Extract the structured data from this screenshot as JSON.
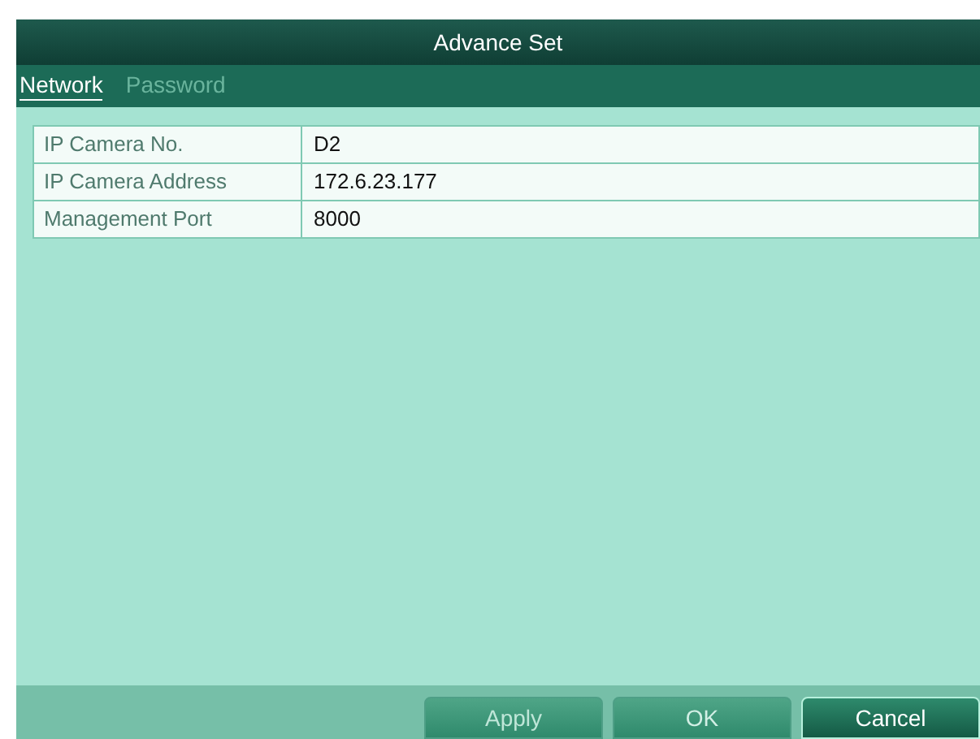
{
  "window": {
    "title": "Advance Set"
  },
  "tabs": [
    {
      "label": "Network",
      "selected": true
    },
    {
      "label": "Password",
      "selected": false
    }
  ],
  "fields": [
    {
      "label": "IP Camera No.",
      "value": "D2"
    },
    {
      "label": "IP Camera Address",
      "value": "172.6.23.177"
    },
    {
      "label": "Management Port",
      "value": "8000"
    }
  ],
  "buttons": [
    {
      "label": "Apply",
      "disabled": true,
      "selected": false
    },
    {
      "label": "OK",
      "disabled": false,
      "selected": false
    },
    {
      "label": "Cancel",
      "disabled": false,
      "selected": true
    }
  ]
}
